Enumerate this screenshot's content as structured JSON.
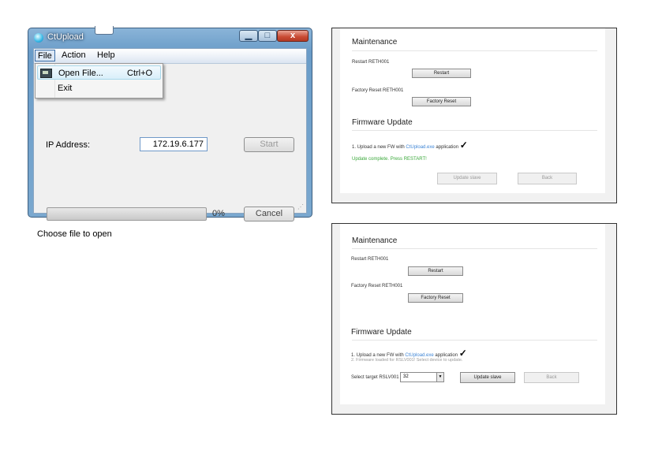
{
  "window": {
    "title": "CtUpload",
    "controls": {
      "minimize": "▁",
      "maximize": "□",
      "close": "x"
    },
    "menu": {
      "file": "File",
      "action": "Action",
      "help": "Help"
    },
    "file_menu": {
      "open_label": "Open File...",
      "open_shortcut": "Ctrl+O",
      "exit_label": "Exit"
    },
    "ip_label": "IP Address:",
    "ip_value": "172.19.6.177",
    "start_label": "Start",
    "progress_percent": 0,
    "progress_text": "0%",
    "cancel_label": "Cancel",
    "status": "Choose file to open",
    "colors": {
      "progress_fill": "#06b025",
      "close_button": "#c94a33"
    }
  },
  "panel1": {
    "maintenance_title": "Maintenance",
    "restart_label": "Restart RETH001",
    "restart_button": "Restart",
    "factory_label": "Factory Reset RETH001",
    "factory_button": "Factory Reset",
    "firmware_title": "Firmware Update",
    "upload_prefix": "1. Upload a new FW with ",
    "upload_link": "CtUpload.exe",
    "upload_suffix": " application",
    "check": "✓",
    "complete_msg": "Update complete. Press RESTART!",
    "update_slave_button": "Update slave",
    "back_button": "Back"
  },
  "panel2": {
    "maintenance_title": "Maintenance",
    "restart_label": "Restart RETH001",
    "restart_button": "Restart",
    "factory_label": "Factory Reset RETH001",
    "factory_button": "Factory Reset",
    "firmware_title": "Firmware Update",
    "upload_prefix": "1. Upload a new FW with ",
    "upload_link": "CtUpload.exe",
    "upload_suffix": " application",
    "check": "✓",
    "loaded_msg": "2. Firmware loaded for RSLV001! Select device to update.",
    "select_label": "Select target RSLV001",
    "select_value": "32",
    "update_slave_button": "Update slave",
    "back_button": "Back"
  }
}
